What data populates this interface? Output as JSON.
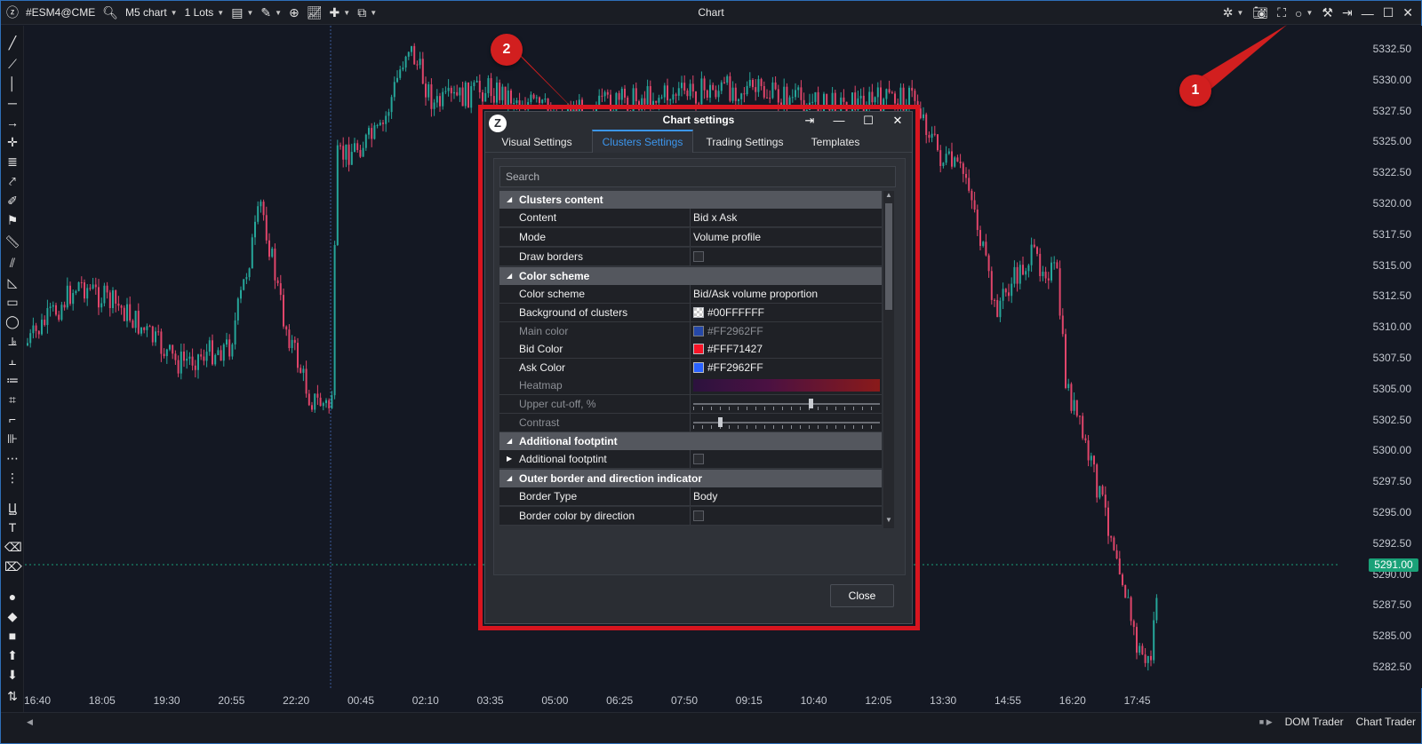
{
  "toolbar": {
    "symbol": "#ESM4@CME",
    "timeframe": "M5 chart",
    "lots": "1 Lots",
    "window_title": "Chart"
  },
  "chart": {
    "price_labels": [
      "5332.50",
      "5330.00",
      "5327.50",
      "5325.00",
      "5322.50",
      "5320.00",
      "5317.50",
      "5315.00",
      "5312.50",
      "5310.00",
      "5307.50",
      "5305.00",
      "5302.50",
      "5300.00",
      "5297.50",
      "5295.00",
      "5292.50",
      "5290.00",
      "5287.50",
      "5285.00",
      "5282.50"
    ],
    "current_price": "5291.00",
    "time_labels": [
      "16:40",
      "18:05",
      "19:30",
      "20:55",
      "22:20",
      "00:45",
      "02:10",
      "03:35",
      "05:00",
      "06:25",
      "07:50",
      "09:15",
      "10:40",
      "12:05",
      "13:30",
      "14:55",
      "16:20",
      "17:45"
    ],
    "colors": {
      "up": "#26a69a",
      "down": "#e0456a",
      "background": "#141823"
    }
  },
  "callouts": {
    "one": "1",
    "two": "2"
  },
  "bottom_bar": {
    "dom_trader": "DOM Trader",
    "chart_trader": "Chart Trader"
  },
  "dialog": {
    "title": "Chart settings",
    "tabs": [
      "Visual Settings",
      "Clusters Settings",
      "Trading Settings",
      "Templates"
    ],
    "active_tab": "Clusters Settings",
    "search_placeholder": "Search",
    "sections": {
      "clusters_content": "Clusters content",
      "color_scheme": "Color scheme",
      "additional_footprint": "Additional footptint",
      "outer_border": "Outer border and direction indicator"
    },
    "rows": {
      "content": {
        "name": "Content",
        "value": "Bid x Ask"
      },
      "mode": {
        "name": "Mode",
        "value": "Volume profile"
      },
      "draw_borders": {
        "name": "Draw borders"
      },
      "color_scheme": {
        "name": "Color scheme",
        "value": "Bid/Ask volume proportion"
      },
      "background_of_clusters": {
        "name": "Background of clusters",
        "value": "#00FFFFFF"
      },
      "main_color": {
        "name": "Main color",
        "value": "#FF2962FF"
      },
      "bid_color": {
        "name": "Bid Color",
        "value": "#FFF71427"
      },
      "ask_color": {
        "name": "Ask Color",
        "value": "#FF2962FF"
      },
      "heatmap": {
        "name": "Heatmap"
      },
      "upper_cutoff": {
        "name": "Upper cut-off, %"
      },
      "contrast": {
        "name": "Contrast"
      },
      "additional_footprint": {
        "name": "Additional footptint"
      },
      "border_type": {
        "name": "Border Type",
        "value": "Body"
      },
      "border_color_by_direction": {
        "name": "Border color by direction"
      }
    },
    "close_label": "Close"
  }
}
